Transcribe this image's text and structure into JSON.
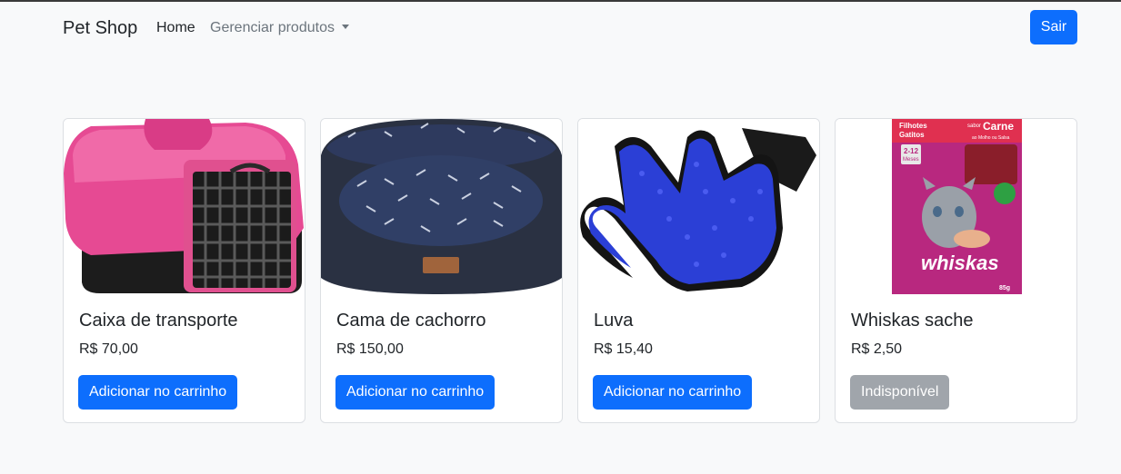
{
  "navbar": {
    "brand": "Pet Shop",
    "home": "Home",
    "manage": "Gerenciar produtos",
    "logout": "Sair"
  },
  "products": [
    {
      "name": "Caixa de transporte",
      "price": "R$ 70,00",
      "action": "Adicionar no carrinho",
      "available": true,
      "image": "pink-pet-carrier"
    },
    {
      "name": "Cama de cachorro",
      "price": "R$ 150,00",
      "action": "Adicionar no carrinho",
      "available": true,
      "image": "dog-bed"
    },
    {
      "name": "Luva",
      "price": "R$ 15,40",
      "action": "Adicionar no carrinho",
      "available": true,
      "image": "grooming-glove"
    },
    {
      "name": "Whiskas sache",
      "price": "R$ 2,50",
      "action": "Indisponível",
      "available": false,
      "image": "whiskas-pouch"
    }
  ],
  "whiskas_pack": {
    "brand": "whiskas",
    "line1": "Filhotes",
    "line2": "Gatitos",
    "age": "2-12",
    "age_unit": "Meses",
    "flavor_prefix": "sabor",
    "flavor": "Carne",
    "sauce": "ao Molho ou Salsa",
    "weight": "85g"
  },
  "colors": {
    "primary": "#0d6efd",
    "disabled": "#a0a5ab",
    "background": "#f8f9fa"
  }
}
